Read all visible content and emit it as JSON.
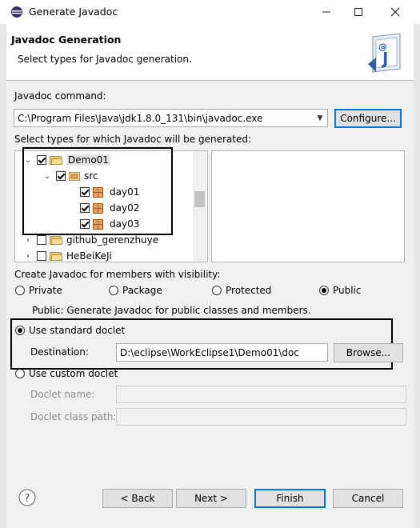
{
  "window": {
    "title": "Generate Javadoc",
    "app_icon": "eclipse-icon"
  },
  "header": {
    "title": "Javadoc Generation",
    "description": "Select types for Javadoc generation.",
    "icon": "javadoc-banner-icon",
    "icon_letters": "@J"
  },
  "javadoc_command": {
    "label": "Javadoc command:",
    "value": "C:\\Program Files\\Java\\jdk1.8.0_131\\bin\\javadoc.exe",
    "configure_label": "Configure..."
  },
  "types": {
    "label": "Select types for which Javadoc will be generated:",
    "tree": [
      {
        "label": "Demo01",
        "checked": true,
        "expanded": true,
        "icon": "project-folder-icon"
      },
      {
        "label": "src",
        "checked": true,
        "expanded": true,
        "icon": "source-folder-icon"
      },
      {
        "label": "day01",
        "checked": true,
        "icon": "package-icon"
      },
      {
        "label": "day02",
        "checked": true,
        "icon": "package-icon"
      },
      {
        "label": "day03",
        "checked": true,
        "icon": "package-icon"
      },
      {
        "label": "github_gerenzhuye",
        "checked": false,
        "expanded": false,
        "icon": "project-folder-icon"
      },
      {
        "label": "HeBeiKeJi",
        "checked": false,
        "expanded": false,
        "icon": "project-folder-icon"
      }
    ]
  },
  "visibility": {
    "label": "Create Javadoc for members with visibility:",
    "options": [
      "Private",
      "Package",
      "Protected",
      "Public"
    ],
    "selected": "Public",
    "info": "Public: Generate Javadoc for public classes and members."
  },
  "standard_doclet": {
    "label": "Use standard doclet",
    "selected": true,
    "destination_label": "Destination:",
    "destination_value": "D:\\eclipse\\WorkEclipse1\\Demo01\\doc",
    "browse_label": "Browse..."
  },
  "custom_doclet": {
    "label": "Use custom doclet",
    "selected": false,
    "name_label": "Doclet name:",
    "class_path_label": "Doclet class path:"
  },
  "footer": {
    "help_icon": "help-icon",
    "back_label": "< Back",
    "next_label": "Next >",
    "finish_label": "Finish",
    "cancel_label": "Cancel"
  }
}
